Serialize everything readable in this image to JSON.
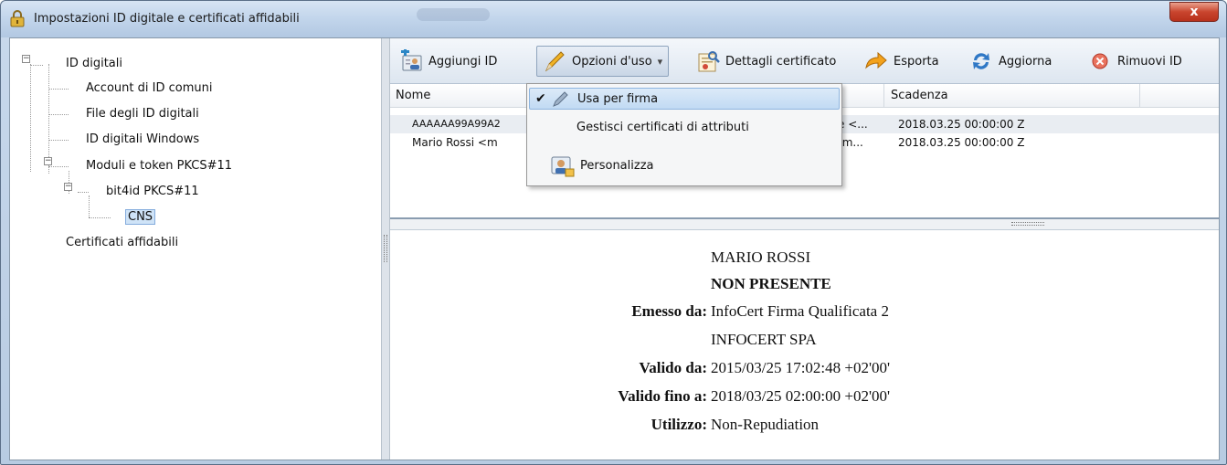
{
  "window": {
    "title": "Impostazioni ID digitale e certificati affidabili",
    "close_label": "x"
  },
  "tree": {
    "items": [
      {
        "label": "ID digitali"
      },
      {
        "label": "Account di ID comuni"
      },
      {
        "label": "File degli ID digitali"
      },
      {
        "label": "ID digitali Windows"
      },
      {
        "label": "Moduli e token PKCS#11"
      },
      {
        "label": "bit4id PKCS#11"
      },
      {
        "label": "CNS"
      },
      {
        "label": "Certificati affidabili"
      }
    ],
    "toggle_symbol": "−"
  },
  "toolbar": {
    "buttons": [
      {
        "label": "Aggiungi ID",
        "icon": "add-id-icon"
      },
      {
        "label": "Opzioni d'uso",
        "icon": "pen-icon",
        "dropdown": "▾"
      },
      {
        "label": "Dettagli certificato",
        "icon": "certificate-icon"
      },
      {
        "label": "Esporta",
        "icon": "export-arrow-icon"
      },
      {
        "label": "Aggiorna",
        "icon": "refresh-icon"
      },
      {
        "label": "Rimuovi ID",
        "icon": "remove-icon"
      }
    ]
  },
  "list": {
    "columns": [
      "Nome",
      "Scadenza"
    ],
    "rows": [
      {
        "name": "AAAAAA99A99A2",
        "middle": "e <...",
        "expiry": "2018.03.25 00:00:00 Z"
      },
      {
        "name": "Mario Rossi <m",
        "middle": "rm...",
        "expiry": "2018.03.25 00:00:00 Z"
      }
    ]
  },
  "menu": {
    "items": [
      {
        "label": "Usa per firma",
        "checked": true,
        "icon": "pen-icon"
      },
      {
        "label": "Gestisci certificati di attributi",
        "checked": false
      },
      {
        "label": "Personalizza",
        "checked": false,
        "icon": "personalize-icon"
      }
    ],
    "check_glyph": "✔"
  },
  "details": {
    "name": "MARIO ROSSI",
    "status": "NON PRESENTE",
    "issued_by_label": "Emesso da:",
    "issued_by": "InfoCert Firma Qualificata 2",
    "issuer_org": "INFOCERT SPA",
    "valid_from_label": "Valido da:",
    "valid_from": "2015/03/25 17:02:48 +02'00'",
    "valid_to_label": "Valido fino a:",
    "valid_to": "2018/03/25 02:00:00 +02'00'",
    "usage_label": "Utilizzo:",
    "usage": "Non-Repudiation"
  },
  "colors": {
    "selection": "#cfe3f7",
    "menu_highlight": "#c1daf3",
    "close_red": "#c9452e"
  }
}
